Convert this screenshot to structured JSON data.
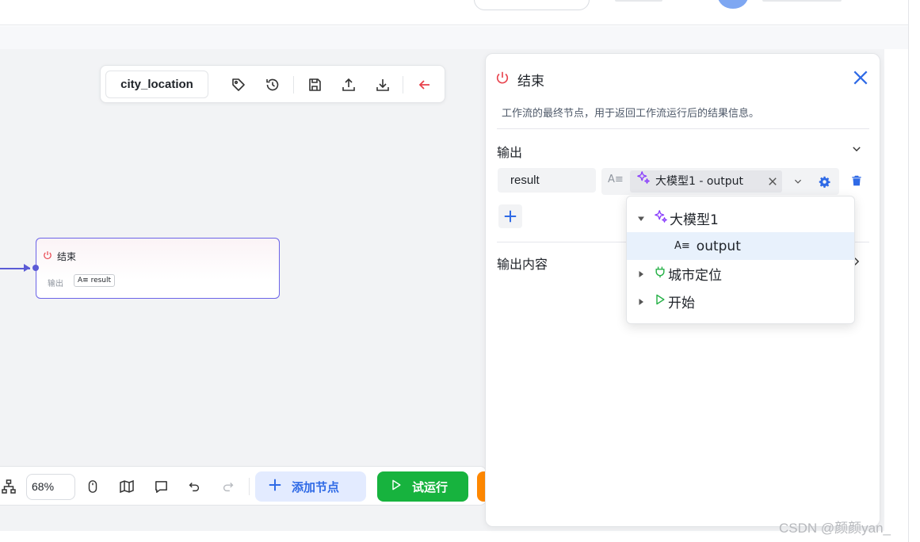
{
  "toolbar": {
    "workflow_name": "city_location"
  },
  "end_node": {
    "title": "结束",
    "output_label": "输出",
    "output_var": "result",
    "type_glyph": "A≡"
  },
  "bottom_toolbar": {
    "zoom": "68%",
    "add_node_label": "添加节点",
    "run_label": "试运行"
  },
  "panel": {
    "title": "结束",
    "description": "工作流的最终节点，用于返回工作流运行后的结果信息。",
    "output_section": "输出",
    "output_content_section": "输出内容",
    "variable_name": "result",
    "variable_type_glyph": "A≡",
    "selected_value": "大模型1 - output"
  },
  "dropdown": {
    "items": [
      {
        "label": "大模型1",
        "icon": "sparkles-icon",
        "expanded": true
      },
      {
        "label": "output",
        "icon": "text-type-icon",
        "selected": true
      },
      {
        "label": "城市定位",
        "icon": "plug-icon",
        "expanded": false
      },
      {
        "label": "开始",
        "icon": "play-icon",
        "expanded": false
      }
    ]
  },
  "watermark": "CSDN @颜颜yan_",
  "colors": {
    "accent_blue": "#2f6ae6",
    "run_green": "#17b33e",
    "node_border": "#6b63e8",
    "end_red": "#e8414b",
    "llm_purple": "#8a3ffc",
    "plug_green": "#27b148"
  }
}
